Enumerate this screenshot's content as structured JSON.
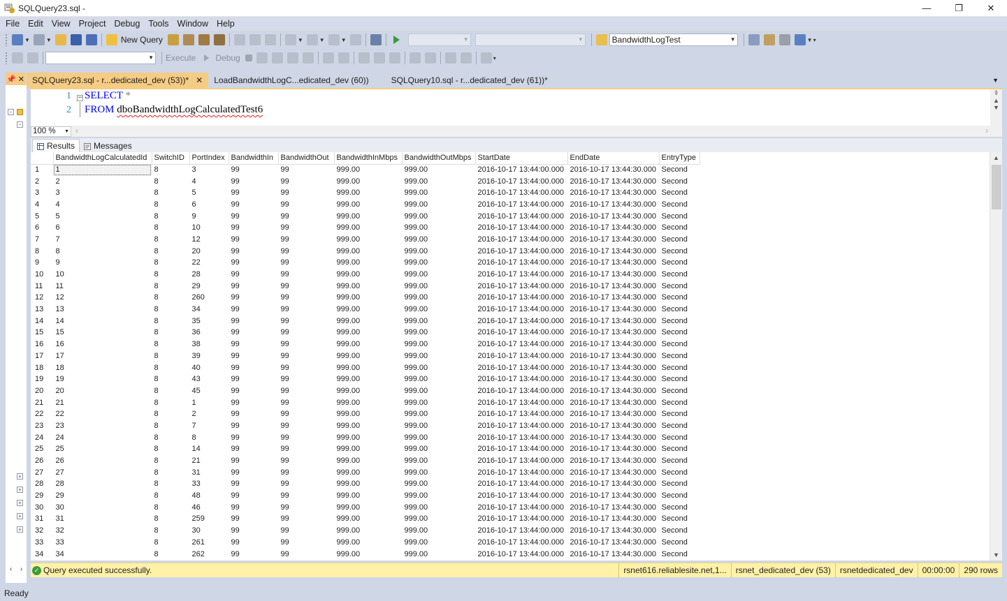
{
  "window": {
    "title": "SQLQuery23.sql -",
    "minimize": "—",
    "restore": "❐",
    "close": "✕"
  },
  "menu": [
    "File",
    "Edit",
    "View",
    "Project",
    "Debug",
    "Tools",
    "Window",
    "Help"
  ],
  "toolbar1": {
    "new_query": "New Query",
    "database": "BandwidthLogTest"
  },
  "toolbar2": {
    "execute": "Execute",
    "debug": "Debug",
    "server_combo_value": ""
  },
  "tabs": [
    {
      "label": "SQLQuery23.sql - r...dedicated_dev (53))*",
      "active": true
    },
    {
      "label": "LoadBandwidthLogC...edicated_dev (60))",
      "active": false
    },
    {
      "label": "SQLQuery10.sql - r...dedicated_dev (61))*",
      "active": false
    }
  ],
  "editor": {
    "lines": [
      {
        "num": "1",
        "keyword": "SELECT",
        "rest": " *"
      },
      {
        "num": "2",
        "keyword": "FROM",
        "rest": "dboBandwidthLogCalculatedTest6"
      }
    ]
  },
  "zoom": "100 %",
  "results_tabs": {
    "results": "Results",
    "messages": "Messages"
  },
  "grid": {
    "columns": [
      "BandwidthLogCalculatedId",
      "SwitchID",
      "PortIndex",
      "BandwidthIn",
      "BandwidthOut",
      "BandwidthInMbps",
      "BandwidthOutMbps",
      "StartDate",
      "EndDate",
      "EntryType"
    ],
    "common": {
      "switch": "8",
      "bw_in": "99",
      "bw_out": "99",
      "in_mbps": "999.00",
      "out_mbps": "999.00",
      "start": "2016-10-17 13:44:00.000",
      "end": "2016-10-17 13:44:30.000",
      "entry": "Second"
    },
    "port_index": [
      "3",
      "4",
      "5",
      "6",
      "9",
      "10",
      "12",
      "20",
      "22",
      "28",
      "29",
      "260",
      "34",
      "35",
      "36",
      "38",
      "39",
      "40",
      "43",
      "45",
      "1",
      "2",
      "7",
      "8",
      "14",
      "21",
      "31",
      "33",
      "48",
      "46",
      "259",
      "30",
      "261",
      "262"
    ]
  },
  "status": {
    "message": "Query executed successfully.",
    "server": "rsnet616.reliablesite.net,1...",
    "user": "rsnet_dedicated_dev (53)",
    "database": "rsnetdedicated_dev",
    "time": "00:00:00",
    "rows": "290 rows"
  },
  "app_status": "Ready",
  "colors": {
    "active_tab": "#f5cc84",
    "status_strip": "#fff2a8",
    "chrome": "#cfd6e5",
    "keyword": "#0000ff",
    "line_number": "#2b91af"
  }
}
